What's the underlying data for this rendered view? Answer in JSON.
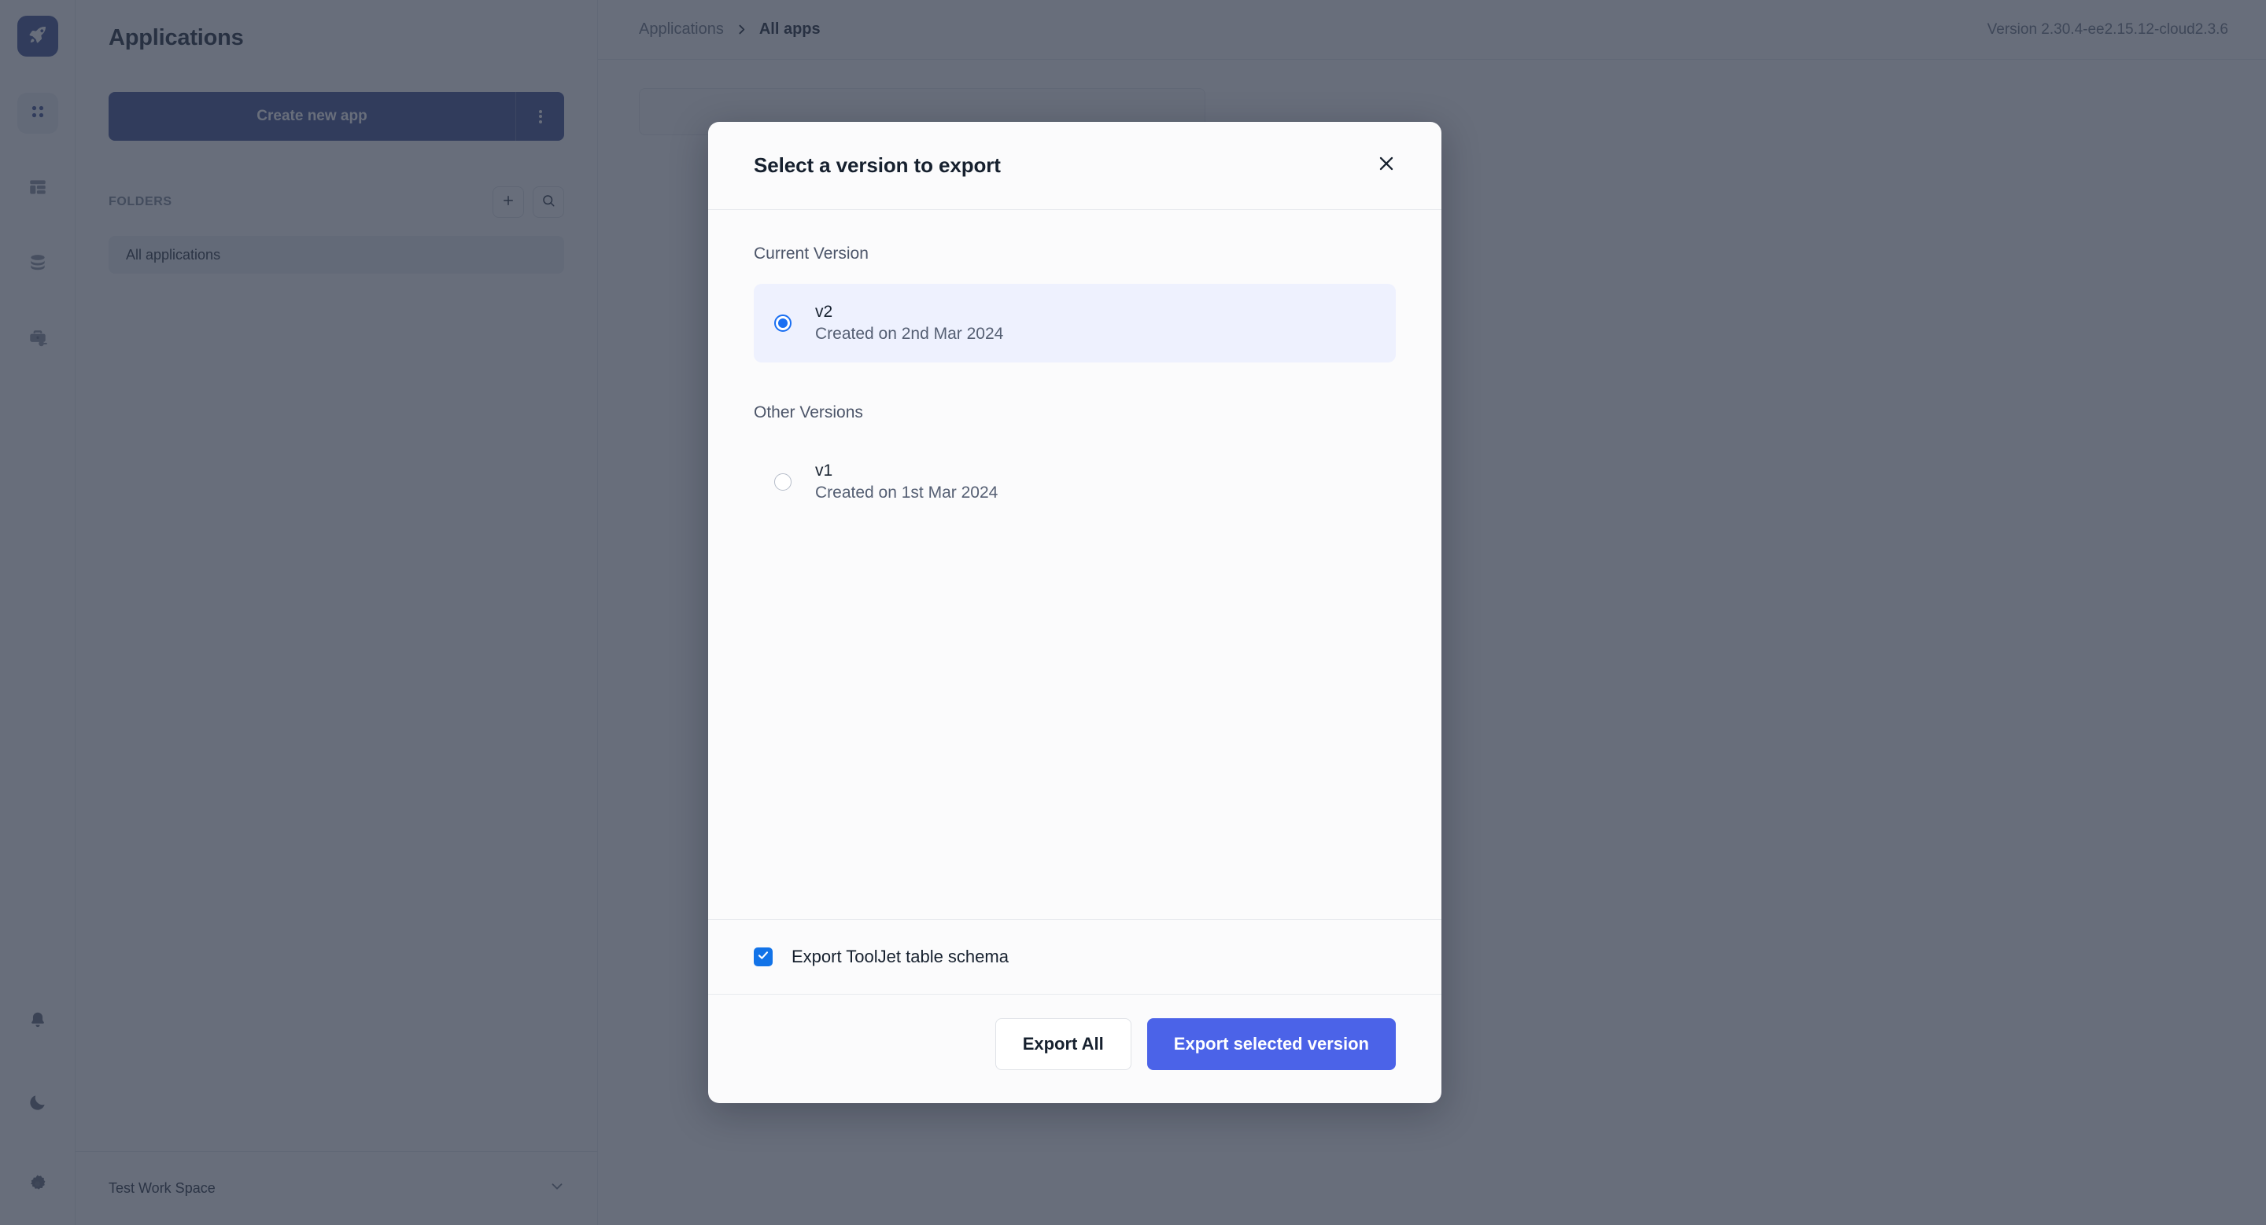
{
  "sidebar_rail": {
    "logo_icon": "rocket-icon",
    "items": [
      {
        "icon": "apps-grid-icon",
        "active": true
      },
      {
        "icon": "layout-template-icon",
        "active": false
      },
      {
        "icon": "database-icon",
        "active": false
      },
      {
        "icon": "workspace-constants-icon",
        "active": false
      }
    ],
    "bottom_items": [
      {
        "icon": "bell-icon"
      },
      {
        "icon": "moon-icon"
      },
      {
        "icon": "gear-icon"
      }
    ]
  },
  "left_panel": {
    "title": "Applications",
    "create_app_label": "Create new app",
    "folders_label": "FOLDERS",
    "add_folder_icon": "plus-icon",
    "search_folder_icon": "search-icon",
    "folder_items": [
      {
        "label": "All applications",
        "selected": true
      }
    ],
    "workspace": {
      "name": "Test Work Space",
      "chevron_icon": "chevron-down-icon"
    }
  },
  "header": {
    "breadcrumb_root": "Applications",
    "breadcrumb_separator_icon": "chevron-right-icon",
    "breadcrumb_current": "All apps",
    "version_text": "Version 2.30.4-ee2.15.12-cloud2.3.6"
  },
  "modal": {
    "title": "Select a version to export",
    "close_icon": "close-icon",
    "current_version_label": "Current Version",
    "other_versions_label": "Other Versions",
    "current_versions": [
      {
        "name": "v2",
        "created": "Created on 2nd Mar 2024",
        "selected": true
      }
    ],
    "other_versions": [
      {
        "name": "v1",
        "created": "Created on 1st Mar 2024",
        "selected": false
      }
    ],
    "schema_checkbox": {
      "label": "Export ToolJet table schema",
      "checked": true,
      "icon": "check-icon"
    },
    "export_all_label": "Export All",
    "export_selected_label": "Export selected version"
  },
  "colors": {
    "overlay": "#2e3648",
    "primary_button": "#4b63e8",
    "checkbox": "#1273e8",
    "radio_accent": "#1a6ff2",
    "selected_row": "#eef1fe",
    "brand_dark": "#3a4d8f"
  }
}
